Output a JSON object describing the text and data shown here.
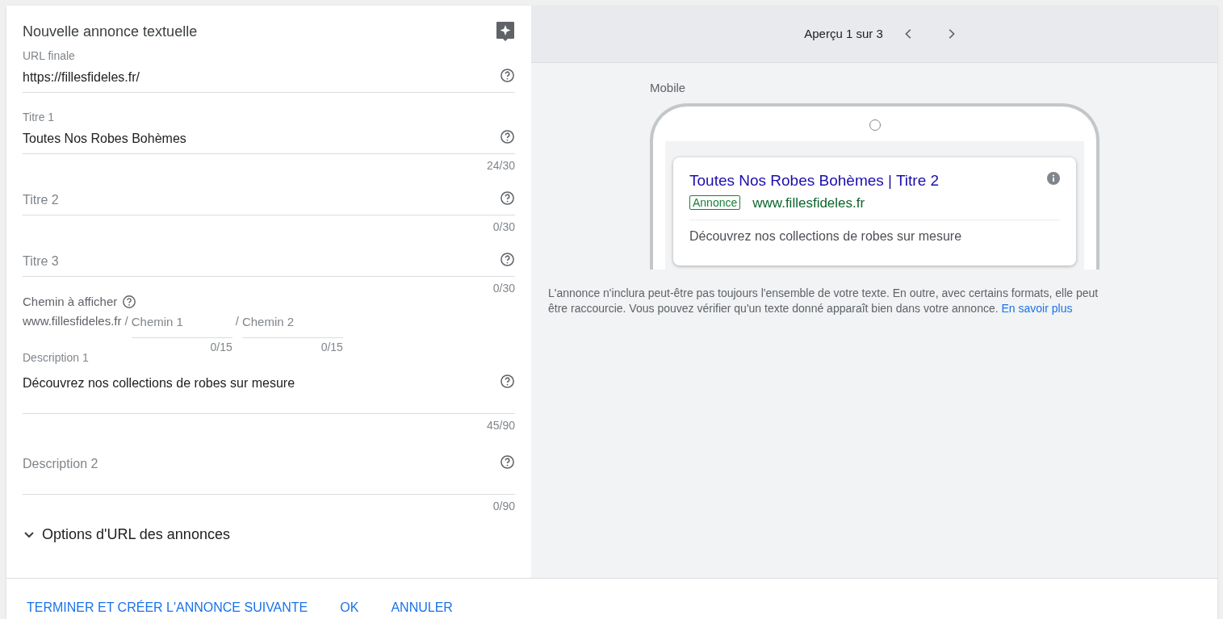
{
  "form": {
    "title": "Nouvelle annonce textuelle",
    "fields": [
      {
        "kind": "single",
        "label": "URL finale",
        "value": "https://fillesfideles.fr/"
      },
      {
        "kind": "single",
        "label": "Titre 1",
        "value": "Toutes Nos Robes Bohèmes",
        "counter": "24/30"
      },
      {
        "kind": "single",
        "label": "Titre 2",
        "counter": "0/30"
      },
      {
        "kind": "single",
        "label": "Titre 3",
        "counter": "0/30"
      },
      {
        "kind": "path",
        "label": "Chemin à afficher",
        "prefix": "www.fillesfideles.fr",
        "parts": [
          {
            "separator": "/",
            "label": "Chemin 1",
            "counter": "0/15"
          },
          {
            "separator": "/",
            "label": "Chemin 2",
            "counter": "0/15"
          }
        ]
      },
      {
        "kind": "multiline",
        "label": "Description 1",
        "value": "Découvrez nos collections de robes sur mesure",
        "counter": "45/90"
      },
      {
        "kind": "multiline",
        "label": "Description 2",
        "counter": "0/90"
      }
    ],
    "options": {
      "label": "Options d'URL des annonces",
      "expanded": false
    }
  },
  "preview": {
    "pager": "Aperçu 1 sur 3",
    "device": "Mobile",
    "ad": {
      "headline": "Toutes Nos Robes Bohèmes | Titre 2",
      "badge": "Annonce",
      "url": "www.fillesfideles.fr",
      "description": "Découvrez nos collections de robes sur mesure"
    },
    "note": "L'annonce n'inclura peut-être pas toujours l'ensemble de votre texte. En outre, avec certains formats, elle peut être raccourcie. Vous pouvez vérifier qu'un texte donné apparaît bien dans votre annonce.",
    "note_link": "En savoir plus"
  },
  "buttons": [
    "TERMINER ET CRÉER L'ANNONCE SUIVANTE",
    "OK",
    "ANNULER"
  ]
}
